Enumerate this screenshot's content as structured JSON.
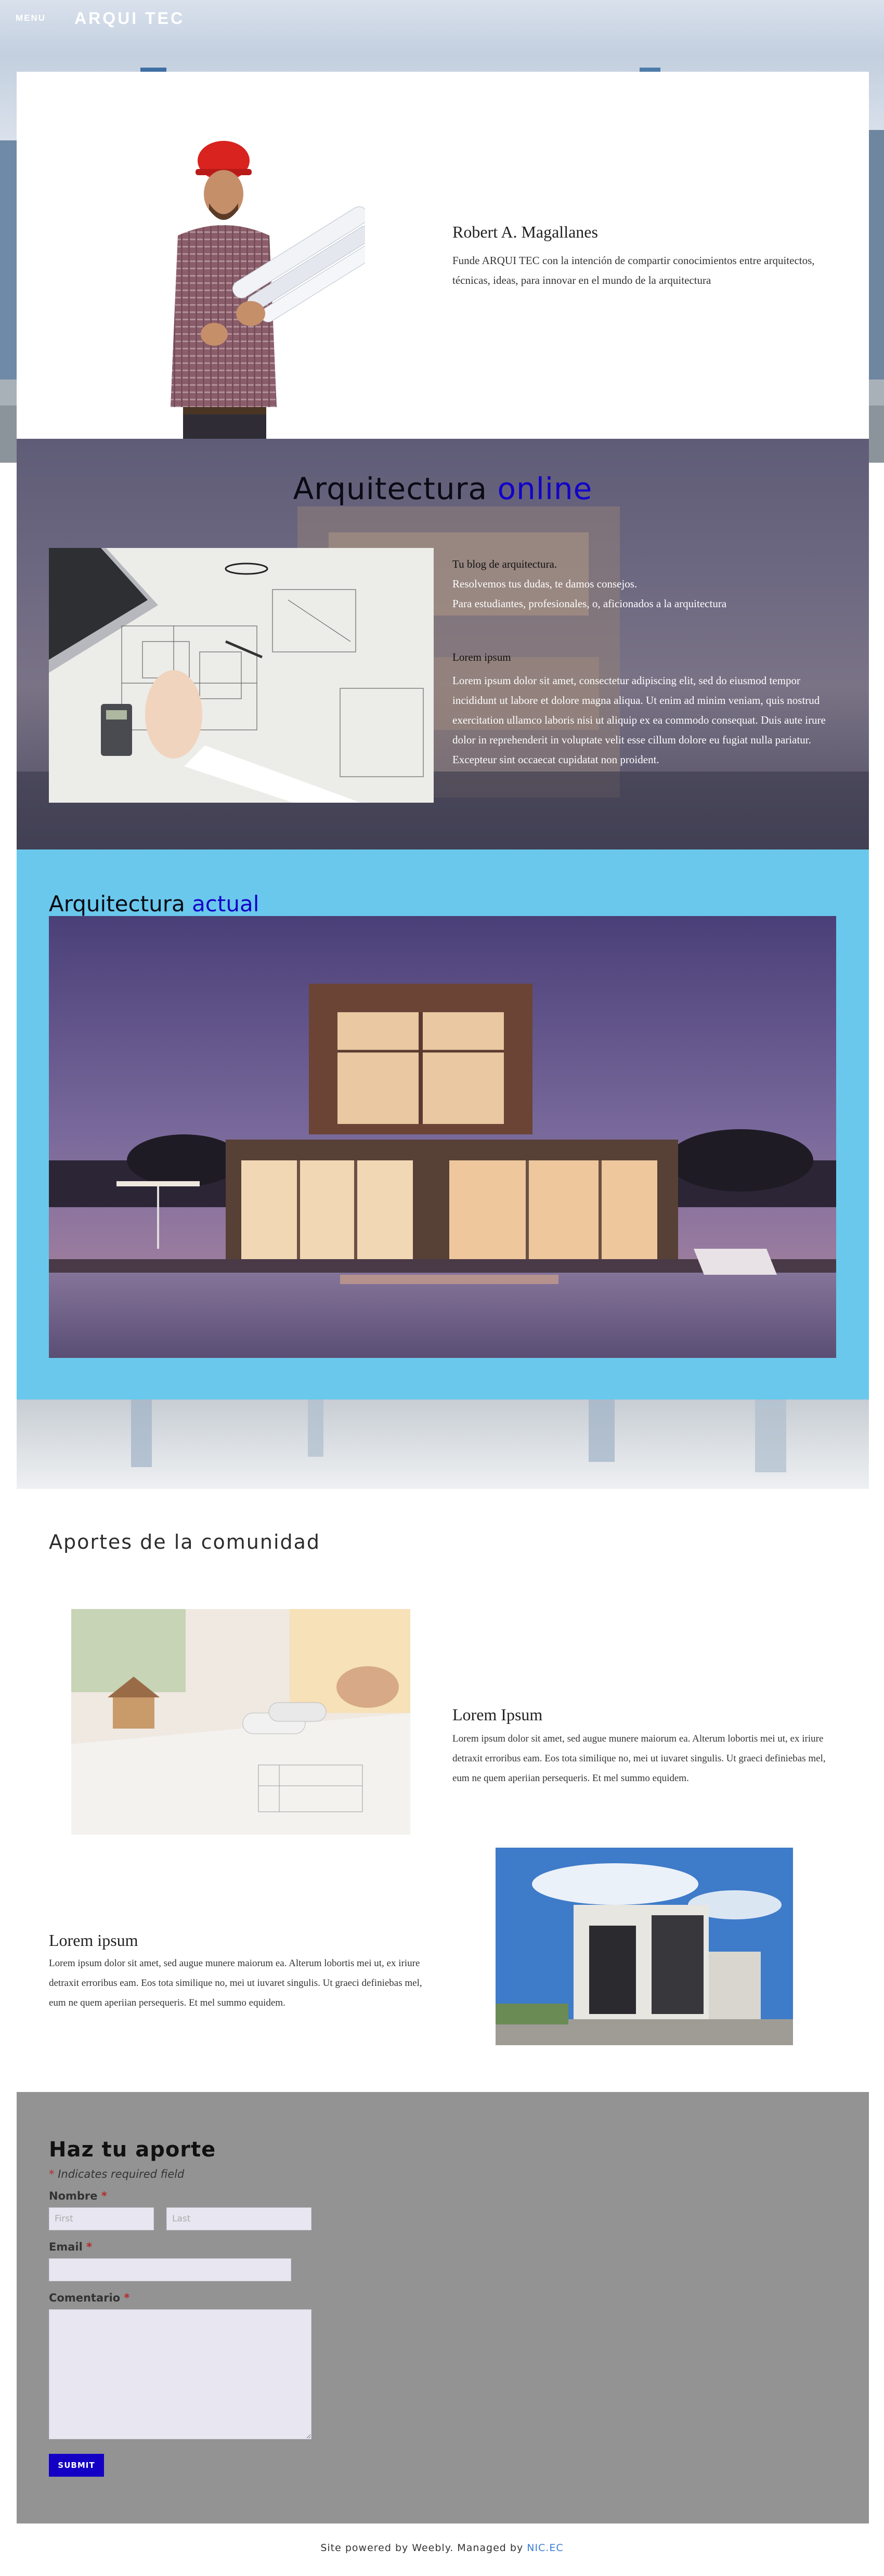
{
  "header": {
    "menu_label": "MENU",
    "brand": "ARQUI TEC"
  },
  "profile": {
    "name": "Robert A. Magallanes",
    "bio": "Funde ARQUI TEC con la intención de compartir conocimientos entre arquitectos, técnicas, ideas, para innovar en el mundo de la arquitectura"
  },
  "online": {
    "title_main": "Arquitectura ",
    "title_accent": "online",
    "intro_1": "Tu blog de arquitectura.",
    "intro_2": "Resolvemos tus dudas, te damos consejos.",
    "intro_3": "Para estudiantes, profesionales, o, aficionados a la arquitectura",
    "lorem_title": "Lorem ipsum",
    "lorem_text": "Lorem ipsum dolor sit amet, consectetur adipiscing elit, sed do eiusmod tempor incididunt ut labore et dolore magna aliqua. Ut enim ad minim veniam, quis nostrud exercitation ullamco laboris nisi ut aliquip ex ea commodo consequat. Duis aute irure dolor in reprehenderit in voluptate velit esse cillum dolore eu fugiat nulla pariatur. Excepteur sint occaecat cupidatat non proident."
  },
  "actual": {
    "title_main": "Arquitectura ",
    "title_accent": "actual"
  },
  "aportes": {
    "title": "Aportes de la comunidad",
    "item1_title": "Lorem Ipsum",
    "item1_text": "Lorem ipsum dolor sit amet, sed augue munere maiorum ea. Alterum lobortis mei ut, ex iriure detraxit erroribus eam. Eos tota similique no, mei ut iuvaret singulis. Ut graeci definiebas mel, eum ne quem aperiian persequeris. Et mel summo equidem.",
    "item2_title": "Lorem ipsum",
    "item2_text": "Lorem ipsum dolor sit amet, sed augue munere maiorum ea. Alterum lobortis mei ut, ex iriure detraxit erroribus eam. Eos tota similique no, mei ut iuvaret singulis. Ut graeci definiebas mel, eum ne quem aperiian persequeris. Et mel summo equidem."
  },
  "form": {
    "title": "Haz tu aporte",
    "required_note": "Indicates required field",
    "required_mark": "*",
    "name_label": "Nombre",
    "first_placeholder": "First",
    "last_placeholder": "Last",
    "email_label": "Email",
    "comment_label": "Comentario",
    "submit_label": "SUBMIT"
  },
  "footer": {
    "text": "Site powered by Weebly. Managed by ",
    "link": "NIC.EC"
  },
  "colors": {
    "accent_blue": "#1200c9",
    "sky_section": "#6ac8ec",
    "form_bg": "#939393",
    "footer_link": "#3b7bd6"
  }
}
